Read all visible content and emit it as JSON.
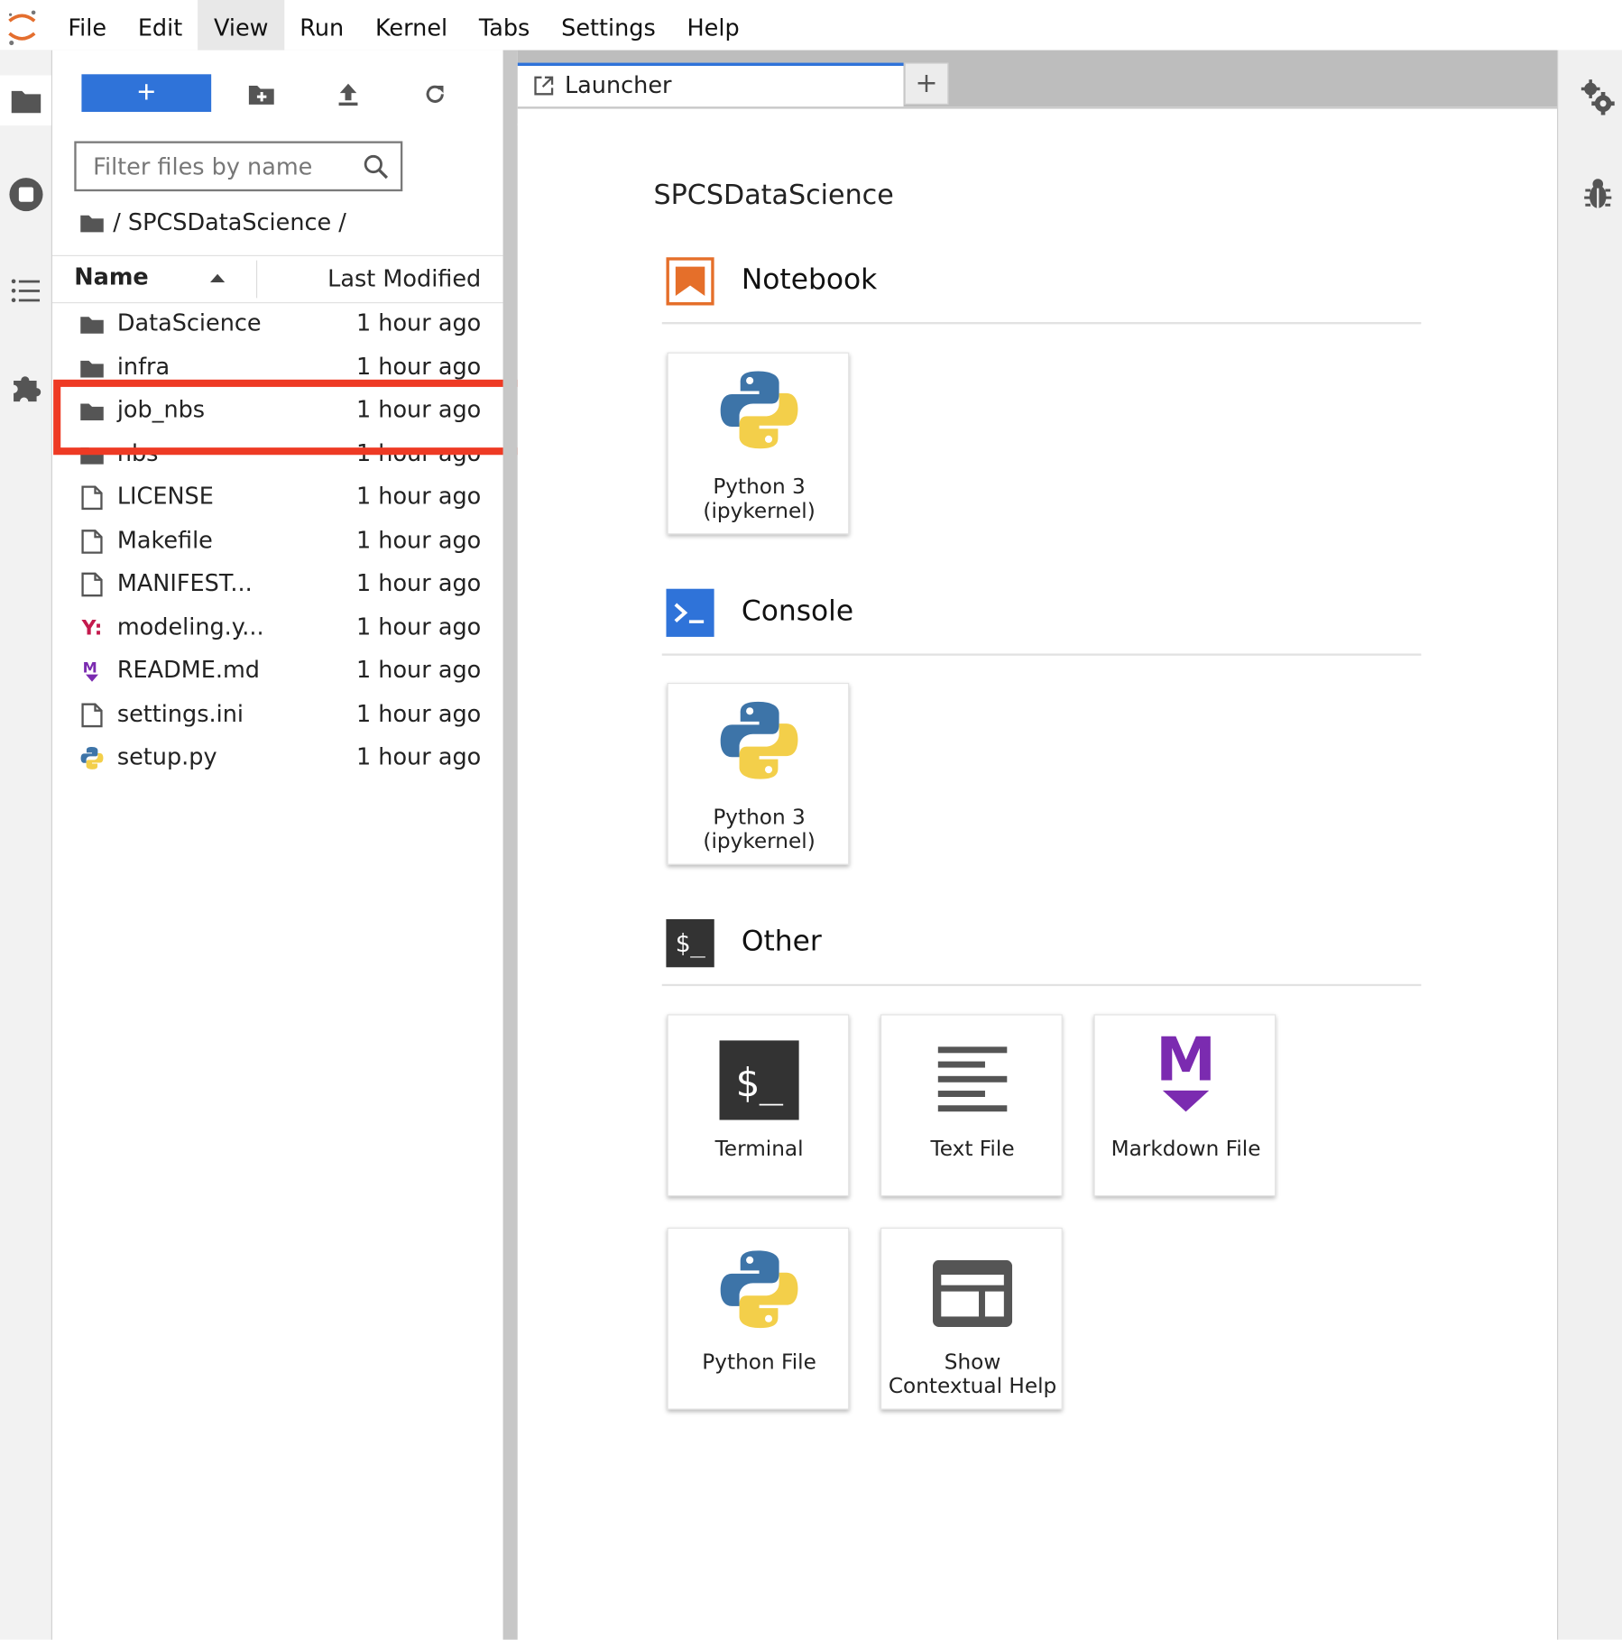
{
  "menubar": {
    "items": [
      "File",
      "Edit",
      "View",
      "Run",
      "Kernel",
      "Tabs",
      "Settings",
      "Help"
    ],
    "active": "View"
  },
  "filebrowser": {
    "new_button_label": "+",
    "filter_placeholder": "Filter files by name",
    "breadcrumb": "/ SPCSDataScience /",
    "columns": {
      "name": "Name",
      "modified": "Last Modified"
    },
    "files": [
      {
        "name": "DataScience",
        "modified": "1 hour ago",
        "icon": "folder-icon"
      },
      {
        "name": "infra",
        "modified": "1 hour ago",
        "icon": "folder-icon"
      },
      {
        "name": "job_nbs",
        "modified": "1 hour ago",
        "icon": "folder-icon"
      },
      {
        "name": "nbs",
        "modified": "1 hour ago",
        "icon": "folder-icon"
      },
      {
        "name": "LICENSE",
        "modified": "1 hour ago",
        "icon": "file-icon"
      },
      {
        "name": "Makefile",
        "modified": "1 hour ago",
        "icon": "file-icon"
      },
      {
        "name": "MANIFEST...",
        "modified": "1 hour ago",
        "icon": "file-icon"
      },
      {
        "name": "modeling.y...",
        "modified": "1 hour ago",
        "icon": "yaml-file-icon"
      },
      {
        "name": "README.md",
        "modified": "1 hour ago",
        "icon": "markdown-file-icon"
      },
      {
        "name": "settings.ini",
        "modified": "1 hour ago",
        "icon": "file-icon"
      },
      {
        "name": "setup.py",
        "modified": "1 hour ago",
        "icon": "python-file-icon"
      }
    ],
    "highlighted_item": "job_nbs"
  },
  "tabs": {
    "launcher_label": "Launcher",
    "add_label": "+"
  },
  "launcher": {
    "cwd": "SPCSDataScience",
    "sections": {
      "notebook": {
        "label": "Notebook",
        "cards": [
          {
            "line1": "Python 3",
            "line2": "(ipykernel)"
          }
        ]
      },
      "console": {
        "label": "Console",
        "cards": [
          {
            "line1": "Python 3",
            "line2": "(ipykernel)"
          }
        ]
      },
      "other": {
        "label": "Other",
        "cards": [
          {
            "label": "Terminal"
          },
          {
            "label": "Text File"
          },
          {
            "label": "Markdown File"
          },
          {
            "label": "Python File"
          },
          {
            "line1": "Show",
            "line2": "Contextual Help"
          }
        ]
      }
    },
    "terminal_glyph": "$_",
    "console_glyph": ">_",
    "markdown_glyph": "M"
  },
  "colors": {
    "accent_blue": "#2f73d9",
    "highlight_red": "#ee3a24",
    "notebook_orange": "#e56f2a",
    "markdown_purple": "#7b2bb0",
    "yaml_red": "#c41a4d"
  }
}
